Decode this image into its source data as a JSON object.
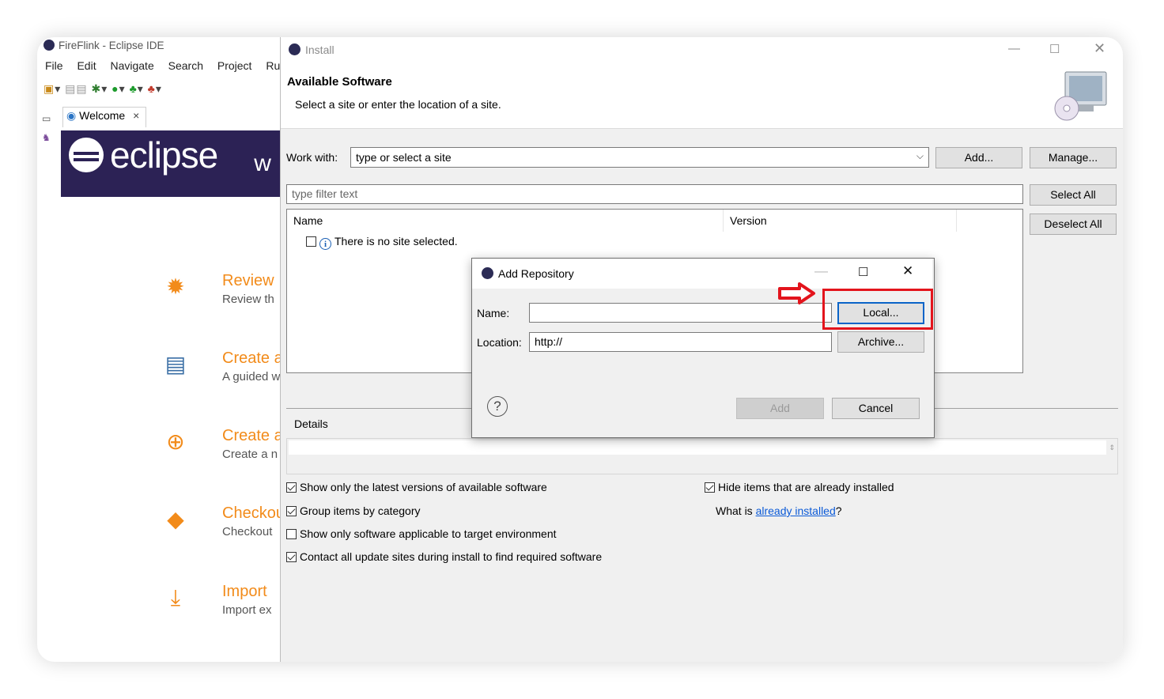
{
  "ide": {
    "title": "FireFlink - Eclipse IDE",
    "menu": [
      "File",
      "Edit",
      "Navigate",
      "Search",
      "Project",
      "Ru"
    ],
    "tab_welcome": "Welcome",
    "tab_close": "×",
    "logo_text": "eclipse",
    "logo_suffix": "w",
    "welcome_items": [
      {
        "title": "Review",
        "desc": "Review th"
      },
      {
        "title": "Create a",
        "desc": "A guided w"
      },
      {
        "title": "Create a",
        "desc": "Create a n"
      },
      {
        "title": "Checkou",
        "desc": "Checkout"
      },
      {
        "title": "Import",
        "desc": "Import ex"
      }
    ]
  },
  "install": {
    "title": "Install",
    "heading": "Available Software",
    "subheading": "Select a site or enter the location of a site.",
    "work_with_label": "Work with:",
    "work_with_value": "type or select a site",
    "add_button": "Add...",
    "manage_button": "Manage...",
    "filter_placeholder": "type filter text",
    "select_all": "Select All",
    "deselect_all": "Deselect All",
    "columns": [
      "Name",
      "Version"
    ],
    "no_site_text": "There is no site selected.",
    "details_label": "Details",
    "options_left": [
      {
        "label": "Show only the latest versions of available software",
        "checked": true
      },
      {
        "label": "Group items by category",
        "checked": true
      },
      {
        "label": "Show only software applicable to target environment",
        "checked": false
      },
      {
        "label": "Contact all update sites during install to find required software",
        "checked": true
      }
    ],
    "hide_installed": "Hide items that are already installed",
    "what_is": "What is ",
    "already_installed_link": "already installed",
    "what_is_suffix": "?"
  },
  "add_repository": {
    "title": "Add Repository",
    "name_label": "Name:",
    "name_value": "",
    "location_label": "Location:",
    "location_value": "http://",
    "local_button": "Local...",
    "archive_button": "Archive...",
    "add_button": "Add",
    "cancel_button": "Cancel",
    "help_glyph": "?"
  }
}
